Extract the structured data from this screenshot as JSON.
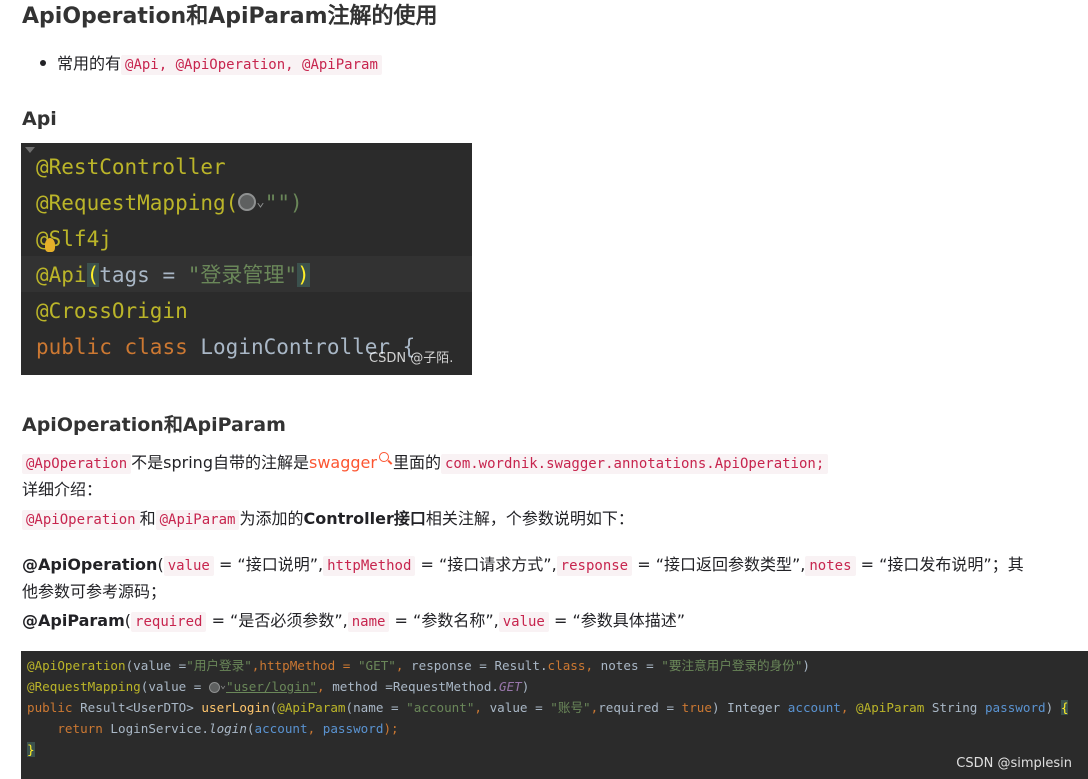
{
  "title": "ApiOperation和ApiParam注解的使用",
  "intro": {
    "prefix": "常用的有",
    "code": "@Api, @ApiOperation, @ApiParam"
  },
  "section_api": {
    "heading": "Api",
    "code_lines": {
      "l1": "@RestController",
      "l2_start": "@RequestMapping(",
      "l2_end": "\"\")",
      "l3": "@Slf4j",
      "l4_ann": "@Api",
      "l4_open": "(",
      "l4_key": "tags",
      "l4_eq": " = ",
      "l4_str": "\"登录管理\"",
      "l4_close": ")",
      "l5": "@CrossOrigin",
      "l6_kw1": "public",
      "l6_kw2": "class",
      "l6_id": "LoginController {"
    },
    "watermark": "CSDN @子陌."
  },
  "section_op": {
    "heading": "ApiOperation和ApiParam",
    "p1": {
      "code1": "@ApOperation",
      "t1": "不是spring自带的注解是",
      "link": "swagger",
      "t2": "里面的",
      "code2": "com.wordnik.swagger.annotations.ApiOperation;"
    },
    "p2": "详细介绍：",
    "p3": {
      "code1": "@ApiOperation",
      "t1": "和",
      "code2": "@ApiParam",
      "t2": "为添加的",
      "bold": "Controller接口",
      "t3": "相关注解，个参数说明如下："
    },
    "p4": {
      "bold": "@ApiOperation",
      "open": "(",
      "c1": "value",
      "t1": "= “接口说明”,",
      "c2": "httpMethod",
      "t2": "= “接口请求方式”,",
      "c3": "response",
      "t3": "= “接口返回参数类型”,",
      "c4": "notes",
      "t4": "= “接口发布说明”；其",
      "line2": "他参数可参考源码；"
    },
    "p5": {
      "bold": "@ApiParam",
      "open": "(",
      "c1": "required",
      "t1": "= “是否必须参数”,",
      "c2": "name",
      "t2": "= “参数名称”,",
      "c3": "value",
      "t3": "= “参数具体描述”"
    }
  },
  "code2": {
    "l1": {
      "ann": "@ApiOperation",
      "a": "(value =",
      "s1": "\"用户登录\"",
      "b": ",httpMethod = ",
      "s2": "\"GET\"",
      "c": ", response = Result.",
      "kw": "class",
      "d": ", notes = ",
      "s3": "\"要注意用户登录的身份\"",
      "e": ")"
    },
    "l2": {
      "ann": "@RequestMapping",
      "a": "(value = ",
      "url": "\"user/login\"",
      "b": ", method =RequestMethod.",
      "get": "GET",
      "c": ")"
    },
    "l3": {
      "kw": "public",
      "a": " Result<UserDTO> ",
      "fn": "userLogin",
      "b": "(",
      "ann1": "@ApiParam",
      "c": "(name = ",
      "s1": "\"account\"",
      "d": ", value = ",
      "s2": "\"账号\"",
      "e": ",required = ",
      "tr": "true",
      "f": ") Integer ",
      "p1": "account",
      "g": ", ",
      "ann2": "@ApiParam",
      "h": " String ",
      "p2": "password",
      "i": ") ",
      "brace": "{"
    },
    "l4": {
      "kw": "return",
      "a": " LoginService.",
      "fn": "login",
      "b": "(",
      "p1": "account",
      "c": ", ",
      "p2": "password",
      "d": ");"
    },
    "l5": "}",
    "watermark": "CSDN @simplesin"
  }
}
